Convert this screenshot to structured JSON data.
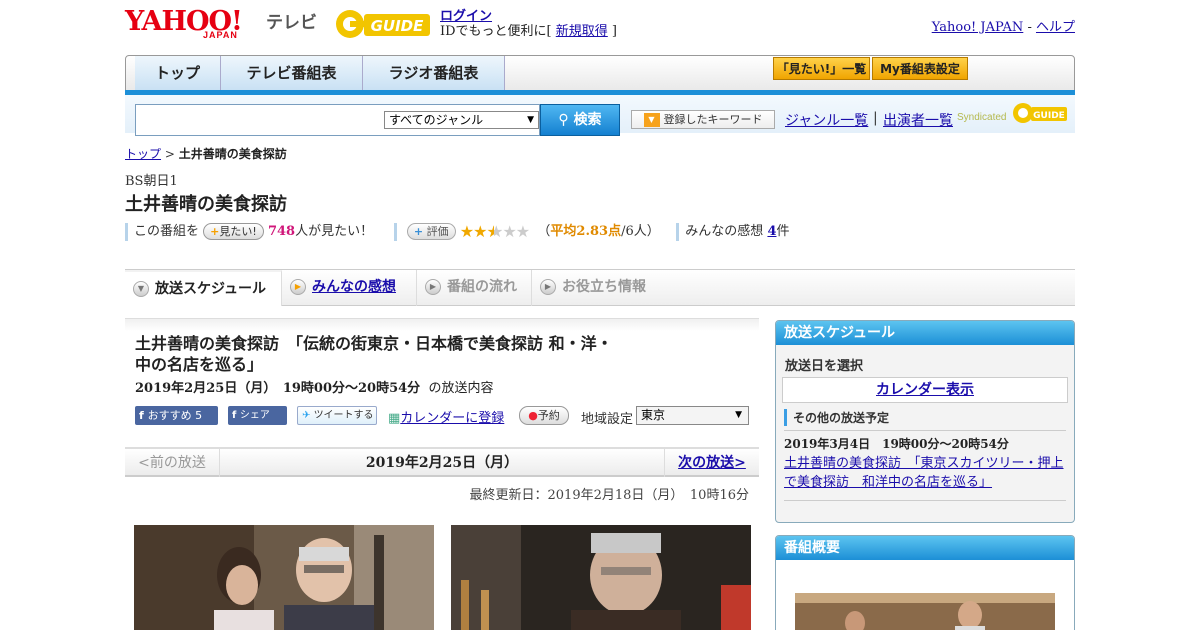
{
  "header": {
    "logo_text": "YAHOO!",
    "logo_sub": "JAPAN",
    "tv_label": "テレビ",
    "gguide_text": "GUIDE",
    "login_link": "ログイン",
    "login_sub_prefix": "IDでもっと便利に[ ",
    "signup_link": "新規取得",
    "login_sub_suffix": " ]",
    "yahoo_japan_link": "Yahoo! JAPAN",
    "help_sep": " - ",
    "help_link": "ヘルプ"
  },
  "nav": {
    "tabs": [
      "トップ",
      "テレビ番組表",
      "ラジオ番組表"
    ],
    "want_list_btn": "「見たい!」一覧",
    "my_schedule_btn": "My番組表設定"
  },
  "search": {
    "input_value": "",
    "genre_selected": "すべてのジャンル",
    "search_btn": "検索",
    "keyword_btn": "登録したキーワード",
    "genre_list_link": "ジャンル一覧",
    "sep": "|",
    "performer_link": "出演者一覧",
    "syndicated": "Syndicated",
    "gguide_small": "GUIDE"
  },
  "breadcrumb": {
    "top_link": "トップ",
    "sep": " > ",
    "current": "土井善晴の美食探訪"
  },
  "program": {
    "channel": "BS朝日1",
    "title": "土井善晴の美食探訪",
    "want_prefix": "この番組を",
    "want_btn": "見たい!",
    "want_count": "748",
    "want_suffix": "人が見たい！",
    "rate_btn": "評価",
    "rating_value": 2.83,
    "rating_open": "（",
    "rating_avg": "平均2.83点",
    "rating_people": "/6人）",
    "impressions_label": "みんなの感想",
    "impressions_count": "4",
    "impressions_unit": "件"
  },
  "tabs": [
    {
      "label": "放送スケジュール",
      "state": "active"
    },
    {
      "label": "みんなの感想",
      "state": "link"
    },
    {
      "label": "番組の流れ",
      "state": "disabled"
    },
    {
      "label": "お役立ち情報",
      "state": "disabled"
    }
  ],
  "episode": {
    "title": "土井善晴の美食探訪　「伝統の街東京・日本橋で美食探訪 和・洋・中の名店を巡る」",
    "datetime": "2019年2月25日（月）　19時00分～20時54分",
    "datetime_suffix": "の放送内容",
    "fb_like": "おすすめ 5",
    "fb_share": "シェア",
    "tweet": "ツイートする",
    "calendar_register": "カレンダーに登録",
    "reserve_btn": "予約",
    "area_label": "地域設定",
    "area_selected": "東京"
  },
  "pager": {
    "prev": "<前の放送",
    "current": "2019年2月25日（月）",
    "next": "次の放送>"
  },
  "updated": "最終更新日：2019年2月18日（月）　10時16分",
  "sidebar": {
    "schedule_title": "放送スケジュール",
    "select_date": "放送日を選択",
    "calendar_show": "カレンダー表示",
    "other_label": "その他の放送予定",
    "other_time": "2019年3月4日　19時00分～20時54分",
    "other_link": "土井善晴の美食探訪　「東京スカイツリー・押上で美食探訪　和洋中の名店を巡る」",
    "summary_title": "番組概要"
  },
  "colors": {
    "yahoo_red": "#e60012",
    "nav_blue": "#1d8fd8",
    "want_count": "#d0177a",
    "rating_avg": "#e08a00"
  }
}
